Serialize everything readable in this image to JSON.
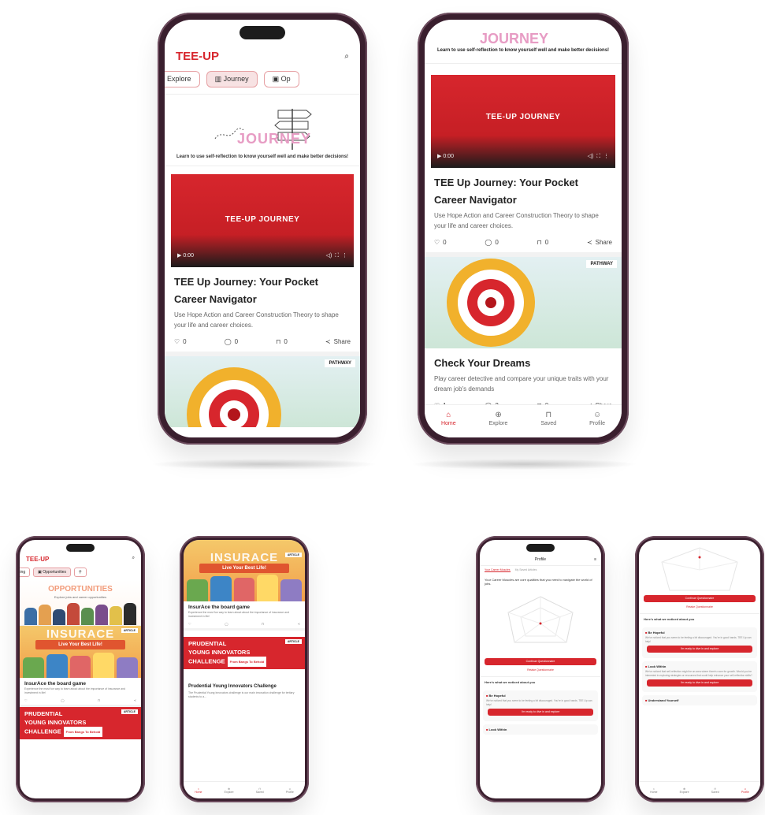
{
  "app": {
    "logo": "TEE-UP"
  },
  "nav_tabs": {
    "explore": "Explore",
    "journey": "Journey",
    "opportunities_partial": "Op",
    "opportunities": "Opportunities",
    "left_partial": "rning"
  },
  "journey_banner": {
    "word": "JOURNEY",
    "tagline": "Learn to use self-reflection to know yourself well and make better decisions!"
  },
  "video": {
    "title": "TEE-UP JOURNEY",
    "time": "0:00"
  },
  "journey_card": {
    "title": "TEE Up Journey: Your Pocket Career Navigator",
    "description": "Use Hope Action and Career Construction Theory to shape your life and career choices.",
    "likes": "0",
    "comments": "0",
    "saves": "0",
    "share": "Share"
  },
  "pathway_badge": "PATHWAY",
  "dreams_card": {
    "title": "Check Your Dreams",
    "description": "Play career detective and compare your unique traits with your dream job's demands",
    "likes": "1",
    "comments": "2",
    "saves": "0",
    "share": "Share"
  },
  "bottom_nav": {
    "home": "Home",
    "explore": "Explore",
    "saved": "Saved",
    "profile": "Profile"
  },
  "opportunities_banner": {
    "title": "OPPORTUNITIES",
    "subtitle": "Explore jobs and career opportunities"
  },
  "insurace": {
    "banner": "INSURACE",
    "ribbon": "Live Your Best Life!",
    "badge": "ARTICLE",
    "title": "InsurAce the board game",
    "description": "Experience the most fun way to learn about about the importance of insurance and investment in life!"
  },
  "prudential": {
    "line1": "PRUDENTIAL",
    "line2": "YOUNG INNOVATORS",
    "line3": "CHALLENGE",
    "pill": "From Bangs To Behold",
    "badge": "ARTICLE",
    "title": "Prudential Young Innovators Challenge",
    "description": "The Prudential Young Innovators challenge is our main innovation challenge for tertiary students to a..."
  },
  "profile": {
    "header": "Profile",
    "tab1": "Your Career Muscles",
    "tab2": "My Saved Articles",
    "intro": "Your Career Muscles are core qualities that you need to navigate the world of jobs.",
    "continue_btn": "Continue Questionnaire",
    "retake_link": "Retake Questionnaire",
    "noticed_heading": "Here's what we noticed about you",
    "be_hopeful": "Be Hopeful",
    "be_hopeful_desc": "We've noticed that you seem to be feeling a bit discouraged. You're in good hands. TEE Up can help!",
    "ready_btn": "I'm ready to dive in and explore",
    "look_within": "Look Within",
    "look_within_desc": "We've noticed that self-reflection might be an area where there's room for growth. Would you be interested in exploring strategies or resources that could help enhance your self-reflection skills?",
    "understand_yourself": "Understand Yourself"
  },
  "colors": {
    "brand_red": "#d7262d",
    "phone_frame": "#3a1f2e",
    "tab_active_bg": "#f7e2e3"
  },
  "icons": [
    "search-icon",
    "compass-icon",
    "chart-icon",
    "briefcase-icon",
    "heart-icon",
    "comment-icon",
    "bookmark-icon",
    "share-icon",
    "home-icon",
    "globe-icon",
    "user-icon",
    "play-icon",
    "volume-icon",
    "fullscreen-icon",
    "more-icon",
    "gear-icon"
  ]
}
